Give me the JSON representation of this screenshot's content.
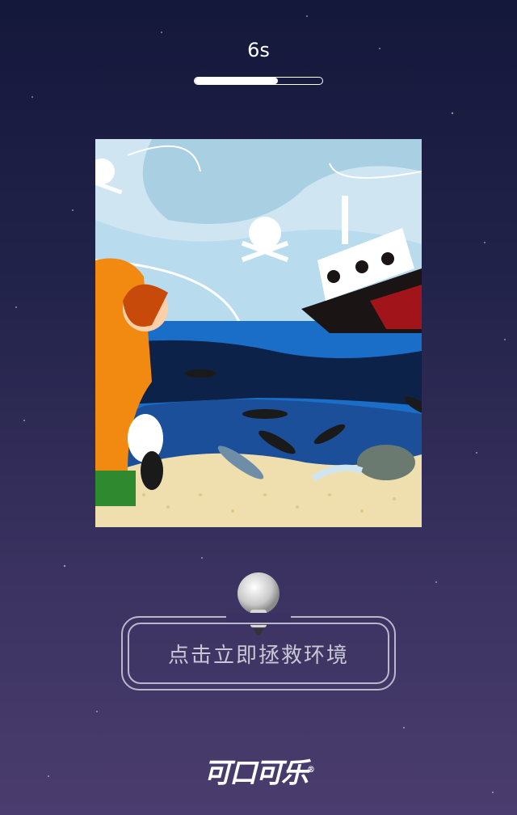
{
  "timer": {
    "seconds_label": "6s"
  },
  "progress": {
    "fraction": 0.65
  },
  "illustration": {
    "description_icon": "oil-spill-scene"
  },
  "cta": {
    "label": "点击立即拯救环境",
    "icon": "lightbulb-icon"
  },
  "brand": {
    "logo_text": "可口可乐",
    "registered": "®"
  },
  "colors": {
    "accent": "#ffffff",
    "button_border": "#b8b8c8"
  }
}
